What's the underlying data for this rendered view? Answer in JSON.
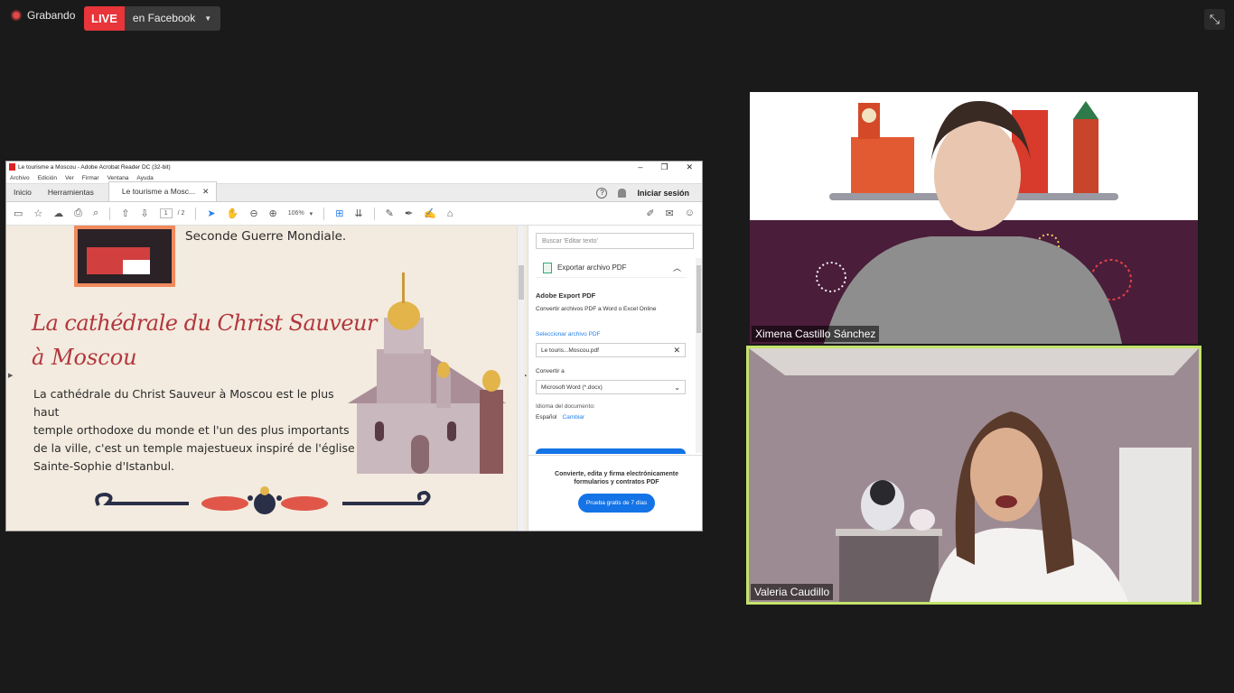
{
  "meeting": {
    "recording_label": "Grabando",
    "live_label": "LIVE",
    "live_target": "en Facebook"
  },
  "acrobat": {
    "window_title": "Le tourisme a Moscou - Adobe Acrobat Reader DC (32-bit)",
    "menu": [
      "Archivo",
      "Edición",
      "Ver",
      "Firmar",
      "Ventana",
      "Ayuda"
    ],
    "tabs": {
      "home": "Inicio",
      "tools": "Herramientas",
      "document": "Le tourisme a Mosc..."
    },
    "sign_in": "Iniciar sesión",
    "page_current": "1",
    "page_total": "/ 2",
    "zoom": "106%",
    "document": {
      "line1": "Seconde Guerre Mondiale.",
      "heading_line1": "La cathédrale du Christ Sauveur",
      "heading_line2": "à Moscou",
      "paragraph_lines": [
        "La cathédrale du Christ Sauveur à Moscou est le plus haut",
        "temple orthodoxe du monde et l'un des plus importants",
        "de la ville, c'est un temple majestueux inspiré de l'église",
        "Sainte-Sophie d'Istanbul."
      ]
    },
    "side_panel": {
      "search_placeholder": "Buscar 'Editar texto'",
      "export_section": "Exportar archivo PDF",
      "title": "Adobe Export PDF",
      "description": "Convertir archivos PDF a Word o Excel Online",
      "select_label": "Seleccionar archivo PDF",
      "file_name": "Le touris...Moscou.pdf",
      "convert_label": "Convertir a",
      "convert_value": "Microsoft Word (*.docx)",
      "language_label": "Idioma del documento:",
      "language_value": "Español",
      "language_change": "Cambiar",
      "promo_text": "Convierte, edita y firma electrónicamente formularios y contratos PDF",
      "promo_button": "Prueba gratis de 7 días"
    }
  },
  "participants": [
    {
      "name": "Ximena Castillo Sánchez"
    },
    {
      "name": "Valeria Caudillo",
      "active_speaker": true
    }
  ],
  "colors": {
    "live_red": "#e8353a",
    "speaker_border": "#c4e36a",
    "heading_red": "#b2373d",
    "acrobat_blue": "#1473e6"
  }
}
